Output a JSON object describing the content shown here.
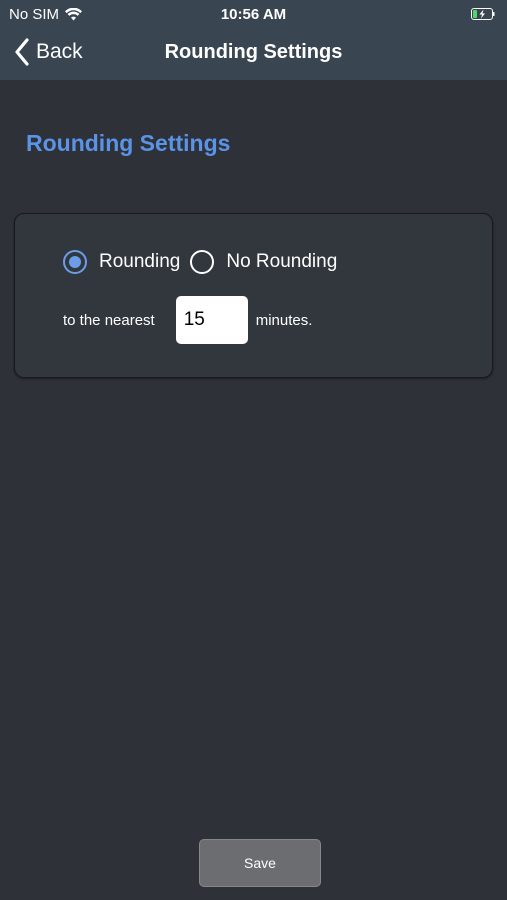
{
  "status_bar": {
    "carrier": "No SIM",
    "time": "10:56 AM",
    "icons": [
      "wifi-icon",
      "battery-icon"
    ]
  },
  "navbar": {
    "back_label": "Back",
    "title": "Rounding Settings"
  },
  "section_title": "Rounding Settings",
  "rounding": {
    "options": [
      {
        "label": "Rounding",
        "selected": true
      },
      {
        "label": "No Rounding",
        "selected": false
      }
    ],
    "nearest_label": "to the nearest",
    "minutes_value": "15",
    "minutes_label": "minutes."
  },
  "footer": {
    "save_label": "Save"
  },
  "colors": {
    "accent": "#5b93e6",
    "background": "#2e3138",
    "navbar": "#3a4552",
    "save_button": "#6b6d70"
  }
}
